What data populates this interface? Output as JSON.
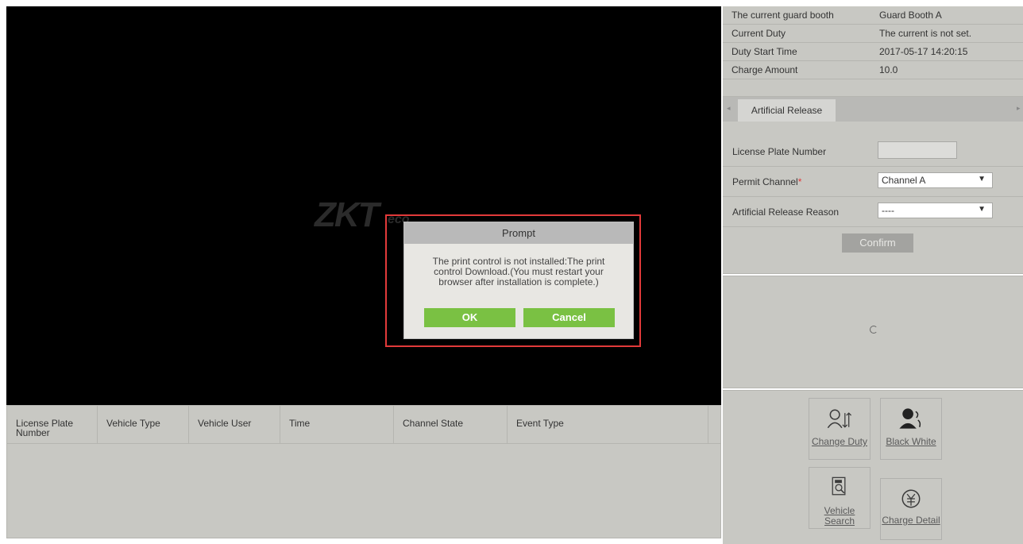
{
  "video": {
    "logo_main": "ZKT",
    "logo_sub": "eco"
  },
  "dialog": {
    "title": "Prompt",
    "message": "The print control is not installed:The print control Download.(You must restart your browser after installation is complete.)",
    "ok_label": "OK",
    "cancel_label": "Cancel",
    "highlight_color": "#e23a3a",
    "button_color": "#7ac143"
  },
  "table": {
    "columns": [
      "License Plate Number",
      "Vehicle Type",
      "Vehicle User",
      "Time",
      "Channel State",
      "Event Type"
    ]
  },
  "info": {
    "rows": [
      {
        "label": "The current guard booth",
        "value": "Guard Booth A"
      },
      {
        "label": "Current Duty",
        "value": "The current is not set."
      },
      {
        "label": "Duty Start Time",
        "value": "2017-05-17 14:20:15"
      },
      {
        "label": "Charge Amount",
        "value": "10.0"
      }
    ]
  },
  "release": {
    "tab_label": "Artificial Release",
    "plate_label": "License Plate Number",
    "plate_value": "",
    "channel_label": "Permit Channel",
    "channel_required_mark": "*",
    "channel_value": "Channel A",
    "reason_label": "Artificial Release Reason",
    "reason_value": "----",
    "confirm_label": "Confirm"
  },
  "actions": {
    "change_duty": "Change Duty",
    "black_white": "Black White",
    "vehicle_search": "Vehicle Search",
    "charge_detail": "Charge Detail"
  }
}
